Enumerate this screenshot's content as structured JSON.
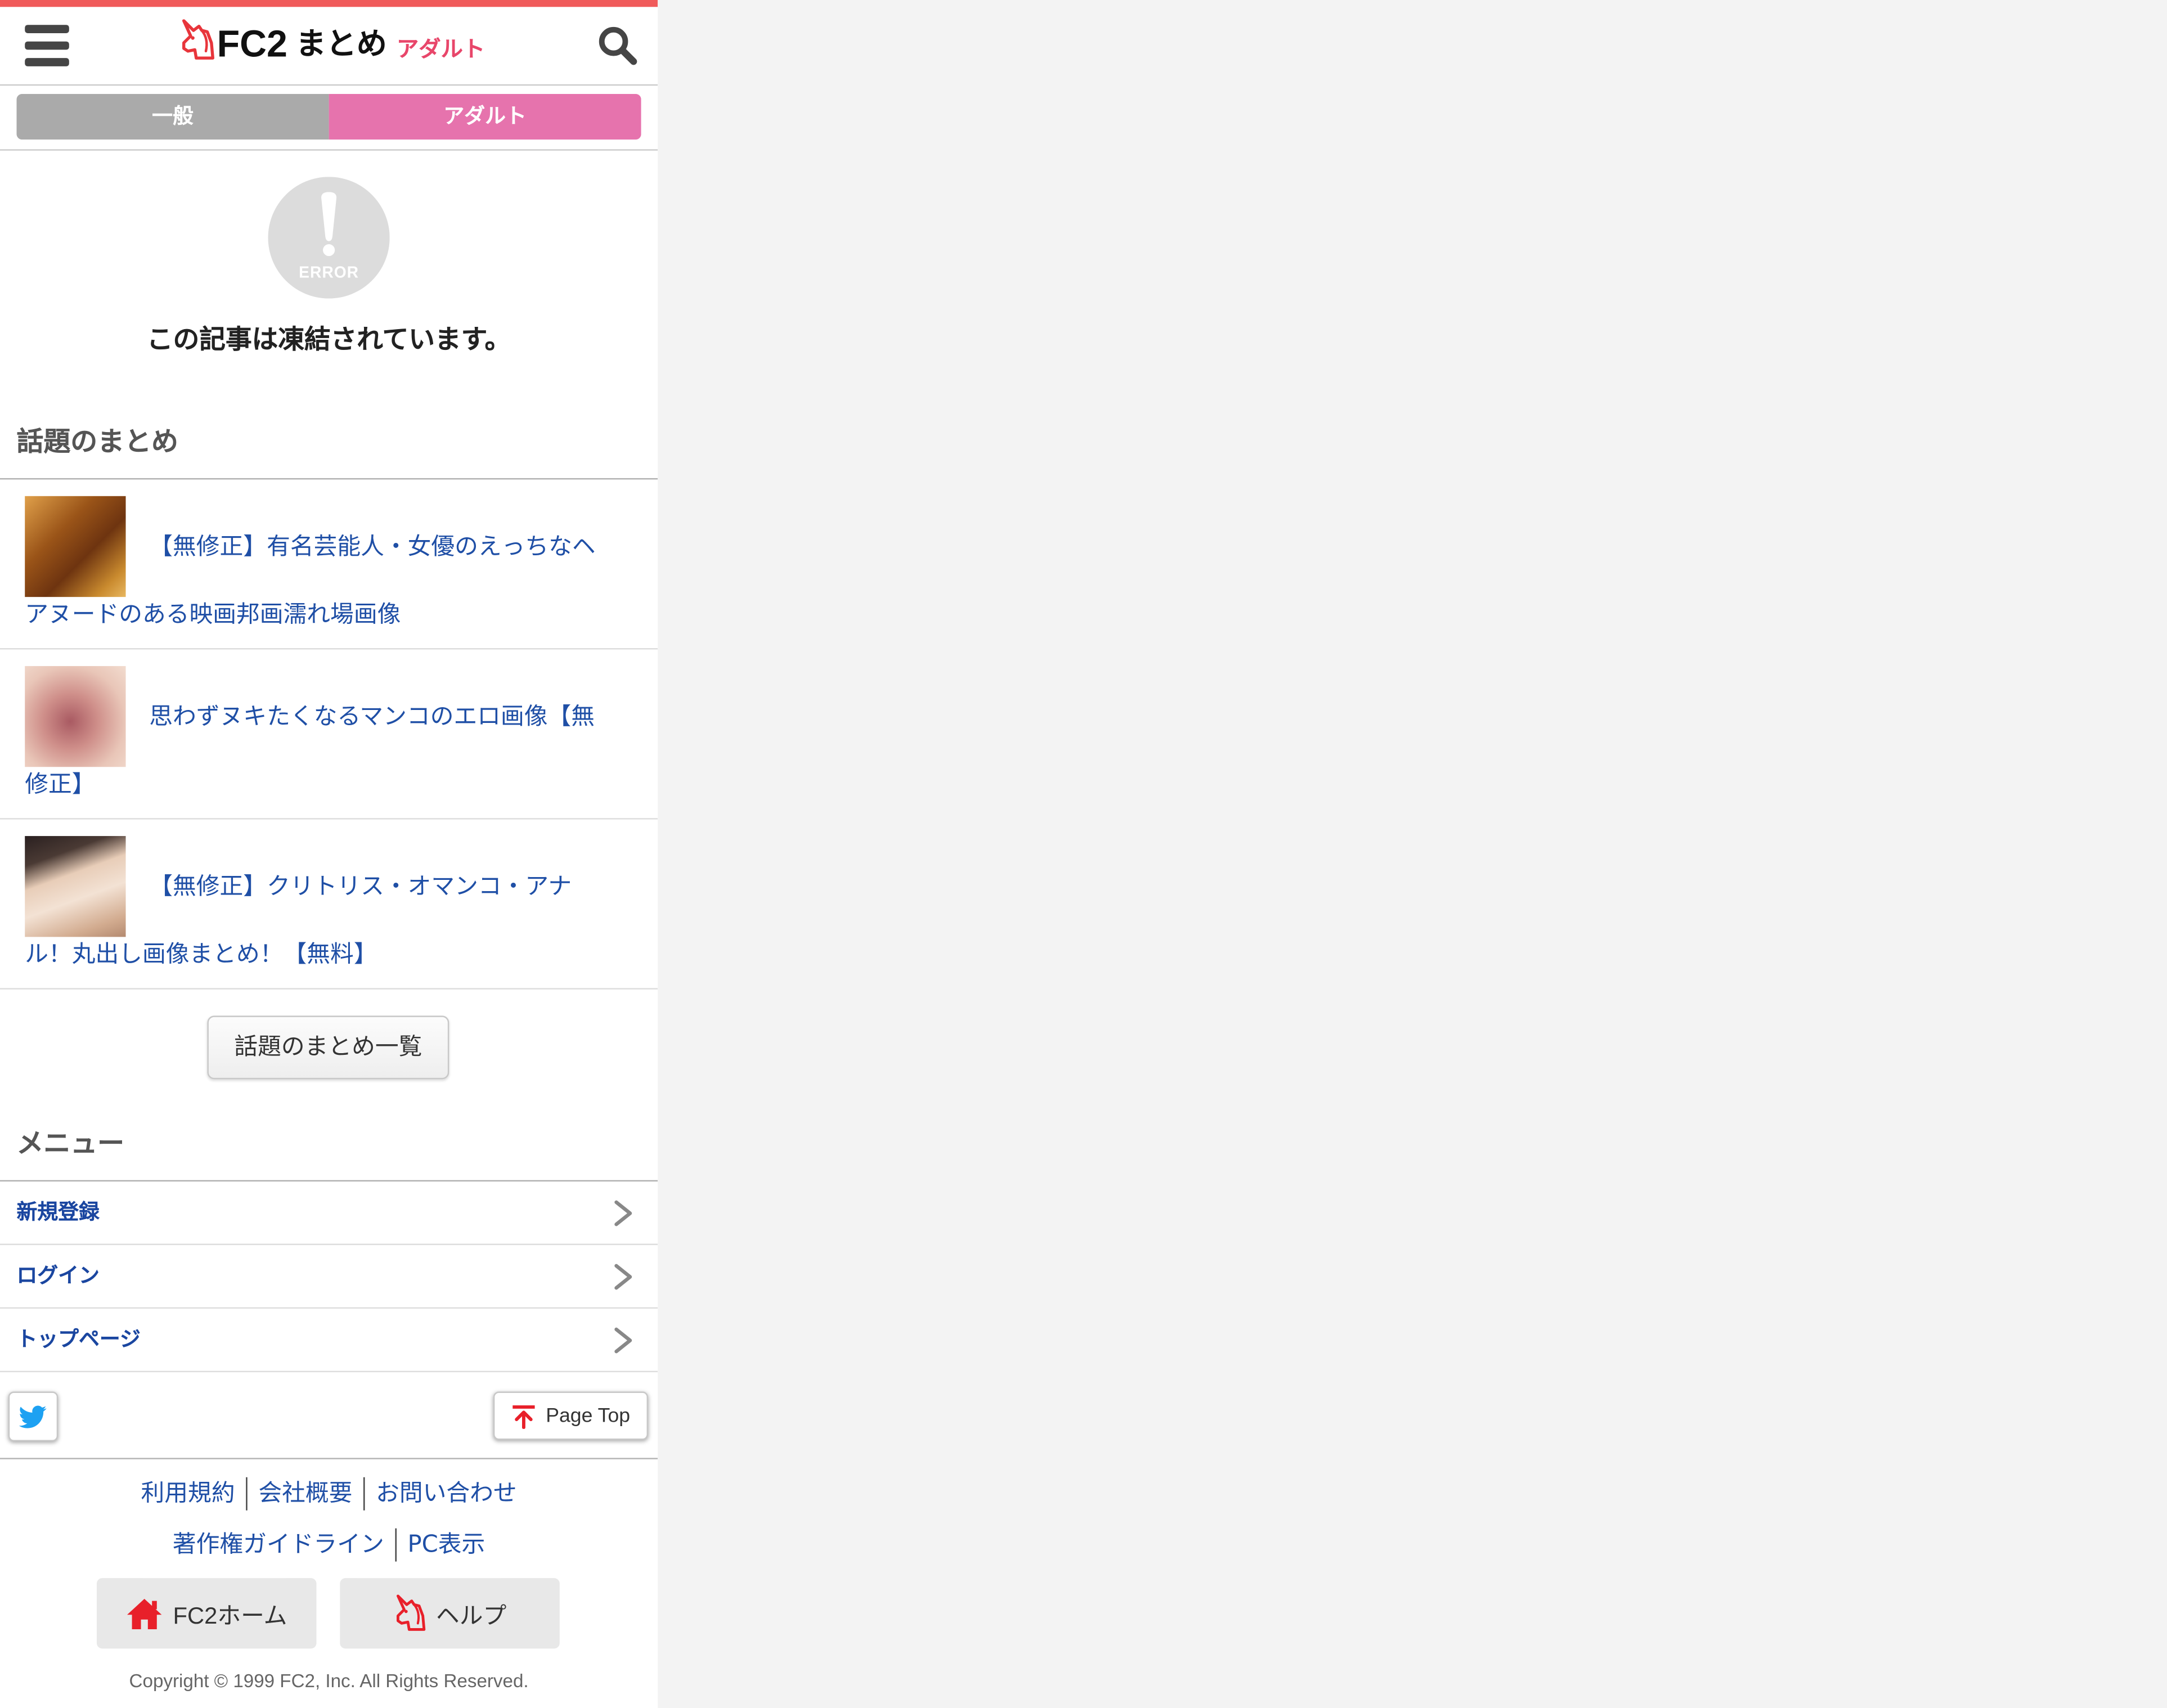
{
  "colors": {
    "top_bar": "#f05a5a",
    "logo_icon": "#e8353b",
    "logo_category": "#e8466a",
    "tab_inactive": "#aaaaaa",
    "tab_active": "#e673ad",
    "link_blue": "#1f4fa6",
    "menu_blue": "#1a46a0",
    "page_background": "#f3f3f3",
    "twitter_blue": "#1da1f2"
  },
  "header": {
    "menu_icon": "hamburger-icon",
    "logo_icon": "unicorn-logo-icon",
    "logo_brand": "FC2",
    "logo_name": "まとめ",
    "logo_category": "アダルト",
    "search_icon": "search-icon"
  },
  "tabs": [
    {
      "label": "一般",
      "active": false
    },
    {
      "label": "アダルト",
      "active": true
    }
  ],
  "error": {
    "icon": "error-icon",
    "icon_label": "ERROR",
    "message": "この記事は凍結されています。"
  },
  "topics": {
    "heading": "話題のまとめ",
    "items": [
      {
        "title": "【無修正】有名芸能人・女優のえっちなヘアヌードのある映画邦画濡れ場画像"
      },
      {
        "title": "思わずヌキたくなるマンコのエロ画像【無修正】"
      },
      {
        "title": "【無修正】クリトリス・オマンコ・アナル！丸出し画像まとめ！【無料】"
      }
    ],
    "more_button": "話題のまとめ一覧"
  },
  "menu": {
    "heading": "メニュー",
    "items": [
      {
        "label": "新規登録",
        "icon": "chevron-right-icon"
      },
      {
        "label": "ログイン",
        "icon": "chevron-right-icon"
      },
      {
        "label": "トップページ",
        "icon": "chevron-right-icon"
      }
    ]
  },
  "toolbar": {
    "share_icon": "twitter-icon",
    "page_top_icon": "arrow-up-icon",
    "page_top_label": "Page Top"
  },
  "footer": {
    "links_row1": [
      "利用規約",
      "会社概要",
      "お問い合わせ"
    ],
    "links_row2": [
      "著作権ガイドライン",
      "PC表示"
    ],
    "buttons": [
      {
        "label": "FC2ホーム",
        "icon": "home-icon"
      },
      {
        "label": "ヘルプ",
        "icon": "unicorn-help-icon"
      }
    ],
    "copyright": "Copyright © 1999 FC2, Inc. All Rights Reserved."
  }
}
